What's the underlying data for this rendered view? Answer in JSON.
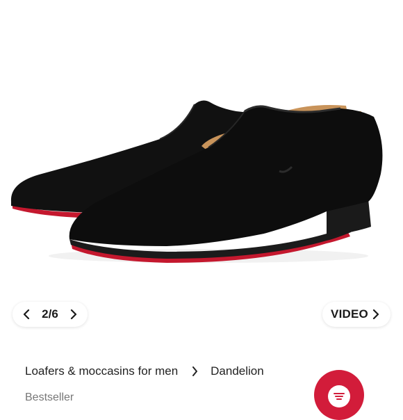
{
  "pager": {
    "counter": "2/6",
    "prev_icon": "chevron-left-icon",
    "next_icon": "chevron-right-icon"
  },
  "video_button": {
    "label": "VIDEO",
    "icon": "chevron-right-icon"
  },
  "breadcrumb": {
    "items": [
      {
        "label": "Loafers & moccasins for men"
      },
      {
        "label": "Dandelion"
      }
    ],
    "separator_icon": "chevron-right-icon"
  },
  "badge": {
    "label": "Bestseller"
  },
  "fab": {
    "icon": "menu-lines-icon",
    "color": "#d21c3a"
  },
  "colors": {
    "sole": "#c4182e",
    "suede": "#0d0d0d",
    "lining": "#c8935a"
  }
}
